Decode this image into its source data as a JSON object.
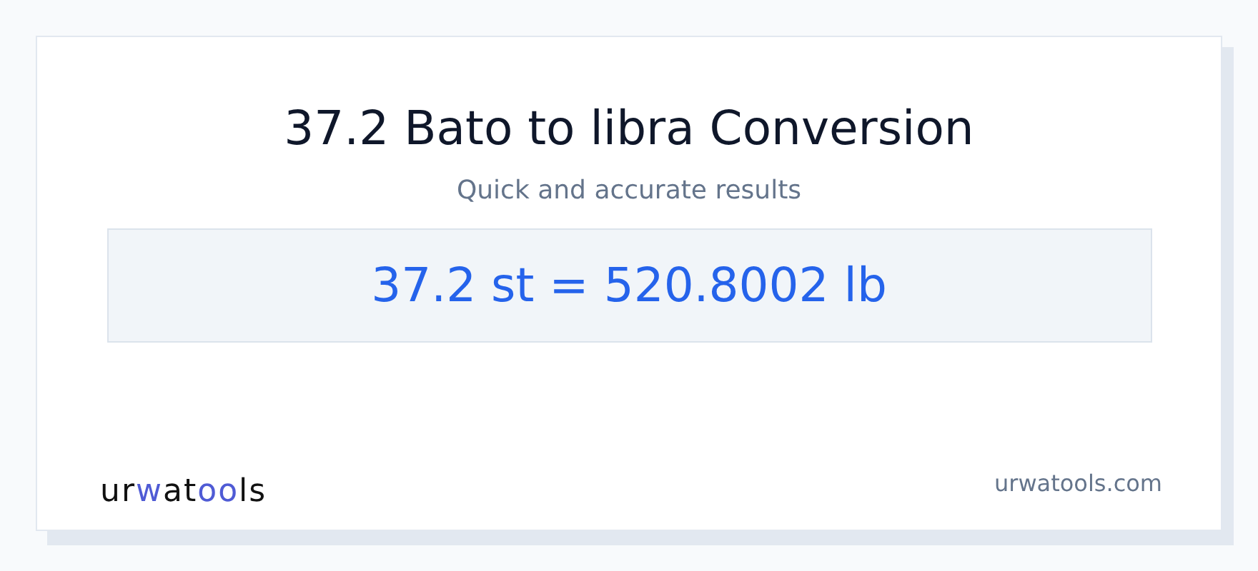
{
  "title": "37.2 Bato to libra Conversion",
  "subtitle": "Quick and accurate results",
  "result": "37.2 st = 520.8002 lb",
  "logo": {
    "segments": [
      {
        "text": "ur",
        "color": "#111111"
      },
      {
        "text": "w",
        "color": "#4f5bd5"
      },
      {
        "text": "at",
        "color": "#111111"
      },
      {
        "text": "oo",
        "color": "#4f5bd5"
      },
      {
        "text": "ls",
        "color": "#111111"
      }
    ]
  },
  "site": "urwatools.com"
}
